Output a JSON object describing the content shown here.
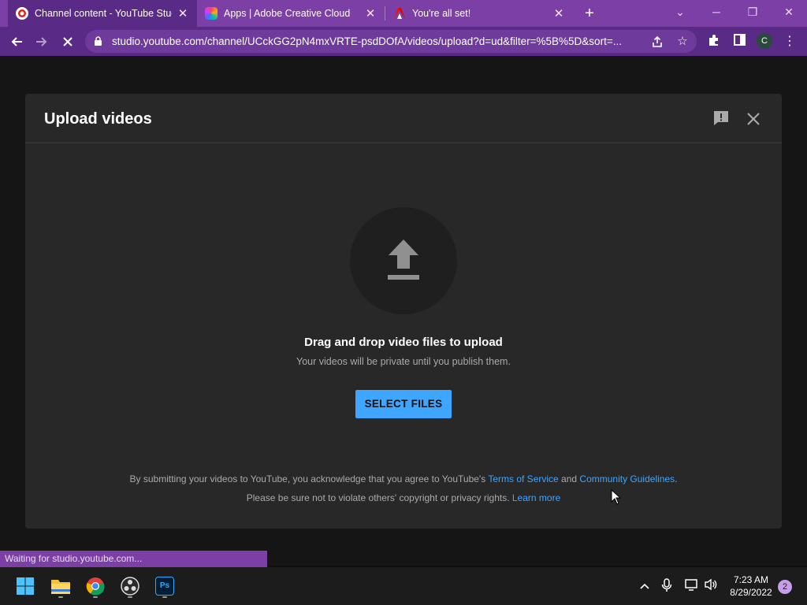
{
  "browser": {
    "tabs": [
      {
        "label": "Channel content - YouTube Studio",
        "active": true
      },
      {
        "label": "Apps | Adobe Creative Cloud",
        "active": false
      },
      {
        "label": "You're all set!",
        "active": false
      }
    ],
    "url": "studio.youtube.com/channel/UCckGG2pN4mxVRTE-psdDOfA/videos/upload?d=ud&filter=%5B%5D&sort=...",
    "profile_initial": "C",
    "status_text": "Waiting for studio.youtube.com..."
  },
  "dialog": {
    "title": "Upload videos",
    "drag_text": "Drag and drop video files to upload",
    "private_text": "Your videos will be private until you publish them.",
    "select_button": "SELECT FILES",
    "legal": {
      "line1_prefix": "By submitting your videos to YouTube, you acknowledge that you agree to YouTube's ",
      "terms_link": "Terms of Service",
      "and": " and ",
      "guidelines_link": "Community Guidelines",
      "line1_suffix": ".",
      "line2_prefix": "Please be sure not to violate others' copyright or privacy rights. ",
      "learn_more_link": "Learn more"
    }
  },
  "taskbar": {
    "time": "7:23 AM",
    "date": "8/29/2022",
    "notification_count": "2",
    "apps": [
      "windows-start-icon",
      "file-explorer-icon",
      "chrome-icon",
      "obs-icon",
      "photoshop-icon"
    ],
    "photoshop_label": "Ps"
  },
  "colors": {
    "tab_strip": "#7b3fa6",
    "toolbar": "#5a2b86",
    "dialog_bg": "#282828",
    "accent_blue": "#3ea6ff"
  }
}
